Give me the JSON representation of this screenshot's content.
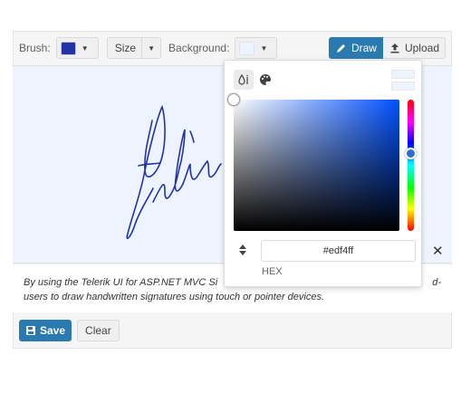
{
  "toolbar": {
    "brush_label": "Brush:",
    "brush_color": "#2233a8",
    "size_label": "Size",
    "background_label": "Background:",
    "background_color": "#edf4ff",
    "draw_label": "Draw",
    "upload_label": "Upload"
  },
  "signature": {
    "stroke_color": "#2233a8",
    "background_color": "#edf4ff"
  },
  "description": "By using the Telerik UI for ASP.NET MVC Si... users to draw handwritten signatures using touch or pointer devices.",
  "description_line1": "By using the Telerik UI for ASP.NET MVC Si",
  "description_line1_end": "d-",
  "description_line2": "users to draw handwritten signatures using touch or pointer devices.",
  "footer": {
    "save_label": "Save",
    "clear_label": "Clear"
  },
  "colorpicker": {
    "hex_value": "#edf4ff",
    "mode_label": "HEX",
    "selected_color": "#edf4ff",
    "hue_color": "#2d6fd0"
  },
  "icons": {
    "draw": "pencil-icon",
    "upload": "upload-icon",
    "save": "floppy-icon",
    "close": "close-icon",
    "gradient_view": "droplet-icon",
    "palette_view": "palette-icon",
    "mode_toggle": "sort-arrows-icon"
  }
}
